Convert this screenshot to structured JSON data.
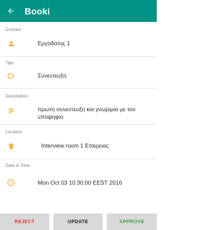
{
  "appbar": {
    "title": "Booki",
    "back_icon": "arrow-left-icon",
    "background_color": "#009485"
  },
  "fields": {
    "contact": {
      "label": "Contact",
      "value": "Εργοδοτης 1",
      "icon": "person-icon"
    },
    "title": {
      "label": "Title",
      "value": "Συνεντευξη",
      "icon": "label-tag-icon"
    },
    "description": {
      "label": "Description",
      "value": "πρωτη συνεντευξη και γνωριμια με τον υποψηφιο",
      "icon": "notes-icon"
    },
    "location": {
      "label": "Location",
      "value": "Interview room 1 Εταιρειας",
      "icon": "location-pin-icon"
    },
    "datetime": {
      "label": "Date & Time",
      "value": "Mon Oct 03 10:30:00 EEST 2016",
      "icon": "clock-icon"
    }
  },
  "icon_color": "#f5a623",
  "actions": {
    "reject_label": "REJECT",
    "update_label": "UPDATE",
    "approve_label": "APPROVE",
    "reject_color": "#e53935",
    "update_color": "#212121",
    "approve_color": "#43a047"
  }
}
